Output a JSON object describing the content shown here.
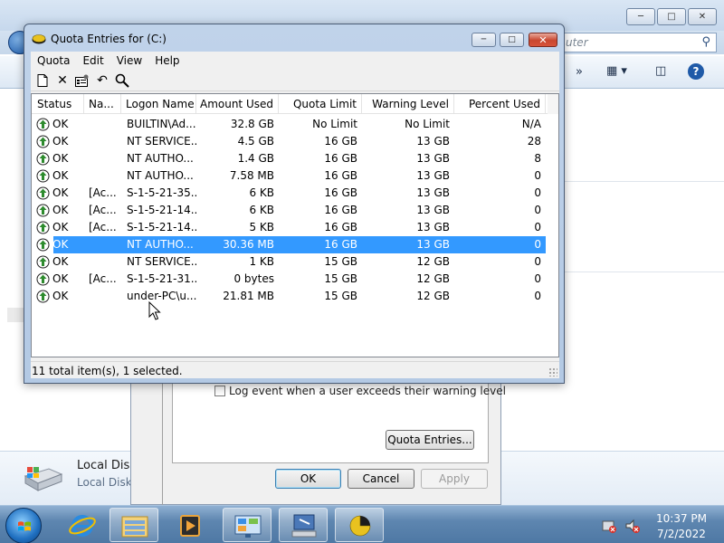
{
  "explorer": {
    "search_placeholder": "uter",
    "details_name": "Local Disk",
    "details_type": "Local Disk"
  },
  "properties": {
    "log_warning_label": "Log event when a user exceeds their warning level",
    "quota_entries_button": "Quota Entries...",
    "ok_button": "OK",
    "cancel_button": "Cancel",
    "apply_button": "Apply"
  },
  "quota_window": {
    "title": "Quota Entries for  (C:)",
    "menu": [
      "Quota",
      "Edit",
      "View",
      "Help"
    ],
    "columns": [
      "Status",
      "Na...",
      "Logon Name",
      "Amount Used",
      "Quota Limit",
      "Warning Level",
      "Percent Used"
    ],
    "rows": [
      {
        "status": "OK",
        "name": "",
        "logon": "BUILTIN\\Ad...",
        "amount": "32.8 GB",
        "limit": "No Limit",
        "warning": "No Limit",
        "percent": "N/A"
      },
      {
        "status": "OK",
        "name": "",
        "logon": "NT SERVICE...",
        "amount": "4.5 GB",
        "limit": "16 GB",
        "warning": "13 GB",
        "percent": "28"
      },
      {
        "status": "OK",
        "name": "",
        "logon": "NT AUTHO...",
        "amount": "1.4 GB",
        "limit": "16 GB",
        "warning": "13 GB",
        "percent": "8"
      },
      {
        "status": "OK",
        "name": "",
        "logon": "NT AUTHO...",
        "amount": "7.58 MB",
        "limit": "16 GB",
        "warning": "13 GB",
        "percent": "0"
      },
      {
        "status": "OK",
        "name": "[Ac...",
        "logon": "S-1-5-21-35...",
        "amount": "6 KB",
        "limit": "16 GB",
        "warning": "13 GB",
        "percent": "0"
      },
      {
        "status": "OK",
        "name": "[Ac...",
        "logon": "S-1-5-21-14...",
        "amount": "6 KB",
        "limit": "16 GB",
        "warning": "13 GB",
        "percent": "0"
      },
      {
        "status": "OK",
        "name": "[Ac...",
        "logon": "S-1-5-21-14...",
        "amount": "5 KB",
        "limit": "16 GB",
        "warning": "13 GB",
        "percent": "0"
      },
      {
        "status": "OK",
        "name": "",
        "logon": "NT AUTHO...",
        "amount": "30.36 MB",
        "limit": "16 GB",
        "warning": "13 GB",
        "percent": "0",
        "selected": true
      },
      {
        "status": "OK",
        "name": "",
        "logon": "NT SERVICE...",
        "amount": "1 KB",
        "limit": "15 GB",
        "warning": "12 GB",
        "percent": "0"
      },
      {
        "status": "OK",
        "name": "[Ac...",
        "logon": "S-1-5-21-31...",
        "amount": "0 bytes",
        "limit": "15 GB",
        "warning": "12 GB",
        "percent": "0"
      },
      {
        "status": "OK",
        "name": "",
        "logon": "under-PC\\u...",
        "amount": "21.81 MB",
        "limit": "15 GB",
        "warning": "12 GB",
        "percent": "0"
      }
    ],
    "status_text": "11 total item(s), 1 selected."
  },
  "taskbar": {
    "time": "10:37 PM",
    "date": "7/2/2022"
  },
  "colors": {
    "selection": "#3399ff",
    "ok_icon_green": "#2e8b2e"
  }
}
